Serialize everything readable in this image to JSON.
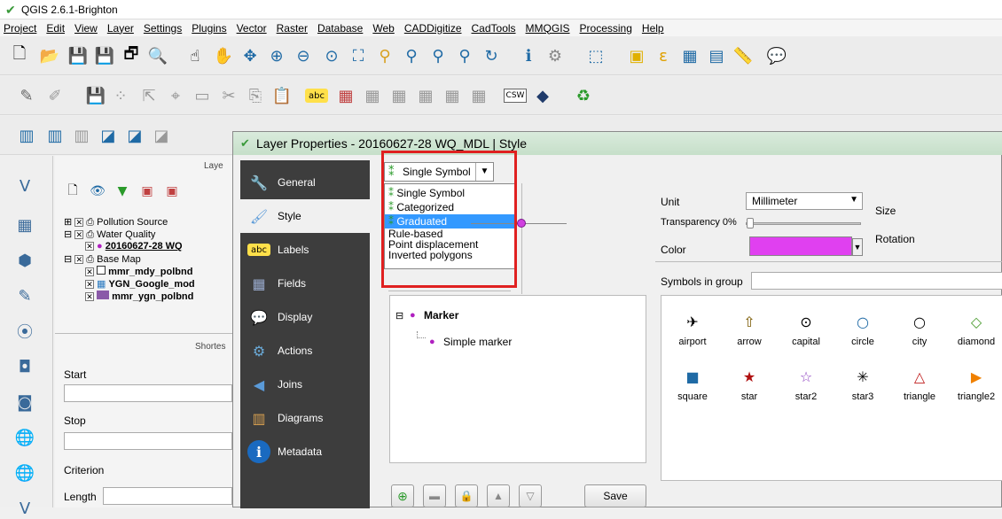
{
  "window": {
    "title": "QGIS 2.6.1-Brighton"
  },
  "menu": [
    "Project",
    "Edit",
    "View",
    "Layer",
    "Settings",
    "Plugins",
    "Vector",
    "Raster",
    "Database",
    "Web",
    "CADDigitize",
    "CadTools",
    "MMQGIS",
    "Processing",
    "Help"
  ],
  "layers_panel": {
    "header": "Laye",
    "items": [
      {
        "label": "Pollution Source",
        "level": 0
      },
      {
        "label": "Water Quality",
        "level": 0
      },
      {
        "label": "20160627-28 WQ",
        "level": 1
      },
      {
        "label": "Base Map",
        "level": 0
      },
      {
        "label": "mmr_mdy_polbnd",
        "level": 1
      },
      {
        "label": "YGN_Google_mod",
        "level": 1
      },
      {
        "label": "mmr_ygn_polbnd",
        "level": 1
      }
    ]
  },
  "shortest_panel": {
    "header": "Shortes",
    "start_label": "Start",
    "stop_label": "Stop",
    "criterion_label": "Criterion",
    "length_label": "Length"
  },
  "dialog": {
    "title": "Layer Properties - 20160627-28  WQ_MDL | Style",
    "nav": [
      {
        "label": "General",
        "icon": "wrench-icon"
      },
      {
        "label": "Style",
        "icon": "brush-icon"
      },
      {
        "label": "Labels",
        "icon": "abc-icon"
      },
      {
        "label": "Fields",
        "icon": "table-icon"
      },
      {
        "label": "Display",
        "icon": "speech-bubble-icon"
      },
      {
        "label": "Actions",
        "icon": "gear-icon"
      },
      {
        "label": "Joins",
        "icon": "joins-icon"
      },
      {
        "label": "Diagrams",
        "icon": "chart-icon"
      },
      {
        "label": "Metadata",
        "icon": "info-icon"
      }
    ],
    "renderer_selected": "Single Symbol",
    "renderer_options": [
      "Single Symbol",
      "Categorized",
      "Graduated",
      "Rule-based",
      "Point displacement",
      "Inverted polygons"
    ],
    "renderer_highlighted": "Graduated",
    "unit_label": "Unit",
    "unit_value": "Millimeter",
    "transparency_label": "Transparency 0%",
    "color_label": "Color",
    "color_value": "#e040f0",
    "size_label": "Size",
    "rotation_label": "Rotation",
    "symbols_in_group_label": "Symbols in group",
    "layer_tree": {
      "root": "Marker",
      "child": "Simple marker"
    },
    "symbols": [
      {
        "name": "airport",
        "glyph": "✈",
        "color": "#000"
      },
      {
        "name": "arrow",
        "glyph": "⇧",
        "color": "#7a5a00"
      },
      {
        "name": "capital",
        "glyph": "⊙",
        "color": "#000"
      },
      {
        "name": "circle",
        "glyph": "○",
        "color": "#1f6aa5"
      },
      {
        "name": "city",
        "glyph": "○",
        "color": "#000"
      },
      {
        "name": "diamond",
        "glyph": "◇",
        "color": "#4a9c2e"
      },
      {
        "name": "square",
        "glyph": "■",
        "color": "#1f6aa5"
      },
      {
        "name": "star",
        "glyph": "★",
        "color": "#b01010"
      },
      {
        "name": "star2",
        "glyph": "☆",
        "color": "#8a3bbf"
      },
      {
        "name": "star3",
        "glyph": "✳",
        "color": "#000"
      },
      {
        "name": "triangle",
        "glyph": "△",
        "color": "#c02020"
      },
      {
        "name": "triangle2",
        "glyph": "▶",
        "color": "#f08000"
      }
    ],
    "save_label": "Save"
  }
}
